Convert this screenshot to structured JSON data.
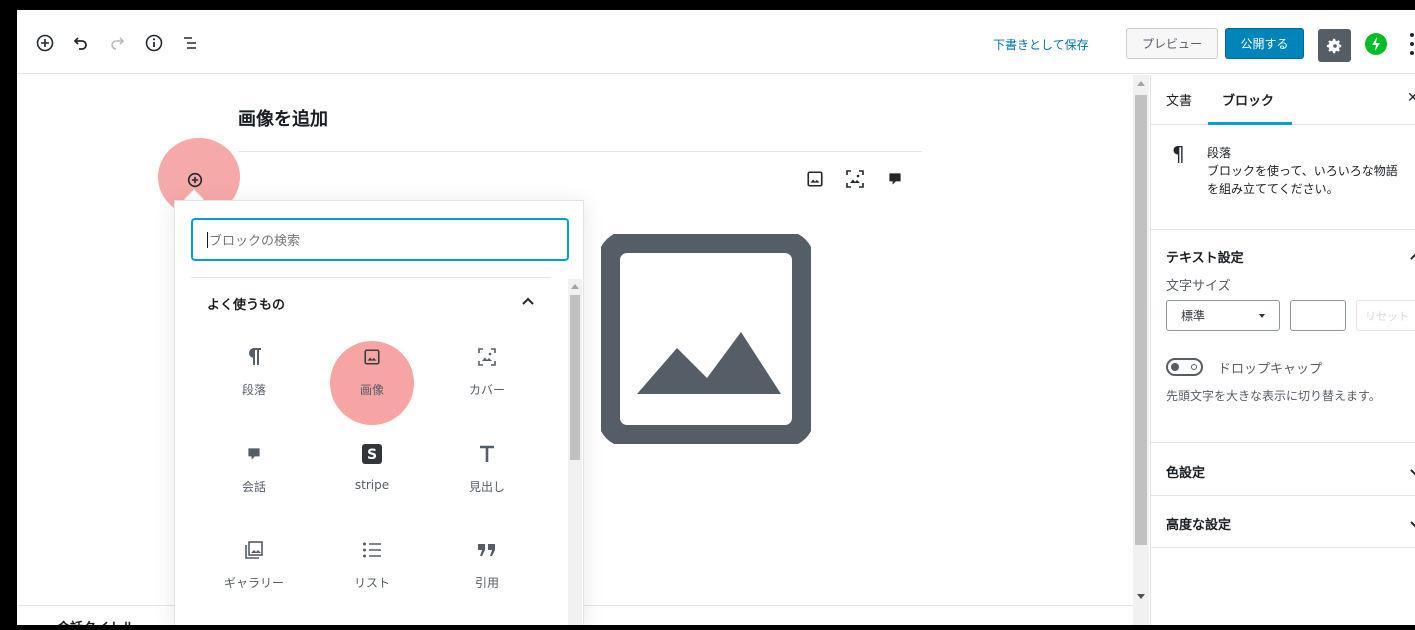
{
  "toolbar": {
    "save_draft": "下書きとして保存",
    "preview": "プレビュー",
    "publish": "公開する"
  },
  "editor": {
    "title": "画像を追加",
    "bottom_text": "会話タイトル"
  },
  "inserter": {
    "search_placeholder": "ブロックの検索",
    "section_title": "よく使うもの",
    "blocks": [
      {
        "label": "段落",
        "icon": "paragraph-icon"
      },
      {
        "label": "画像",
        "icon": "image-icon"
      },
      {
        "label": "カバー",
        "icon": "cover-icon"
      },
      {
        "label": "会話",
        "icon": "speech-bubble-icon"
      },
      {
        "label": "stripe",
        "icon": "stripe-icon"
      },
      {
        "label": "見出し",
        "icon": "heading-icon"
      },
      {
        "label": "ギャラリー",
        "icon": "gallery-icon"
      },
      {
        "label": "リスト",
        "icon": "list-icon"
      },
      {
        "label": "引用",
        "icon": "quote-icon"
      }
    ]
  },
  "sidebar": {
    "tabs": [
      "文書",
      "ブロック"
    ],
    "active_tab": "ブロック",
    "block_name": "段落",
    "block_description": "ブロックを使って、いろいろな物語\nを組み立ててください。",
    "text_settings_title": "テキスト設定",
    "font_size_label": "文字サイズ",
    "font_size_value": "標準",
    "reset_label": "リセット",
    "drop_cap_label": "ドロップキャップ",
    "drop_cap_help": "先頭文字を大きな表示に切り替えます。",
    "color_settings_title": "色設定",
    "advanced_title": "高度な設定"
  },
  "colors": {
    "accent": "#0085ba",
    "link": "#0073aa",
    "highlight": "#f59a9a",
    "jetpack": "#00be28"
  }
}
